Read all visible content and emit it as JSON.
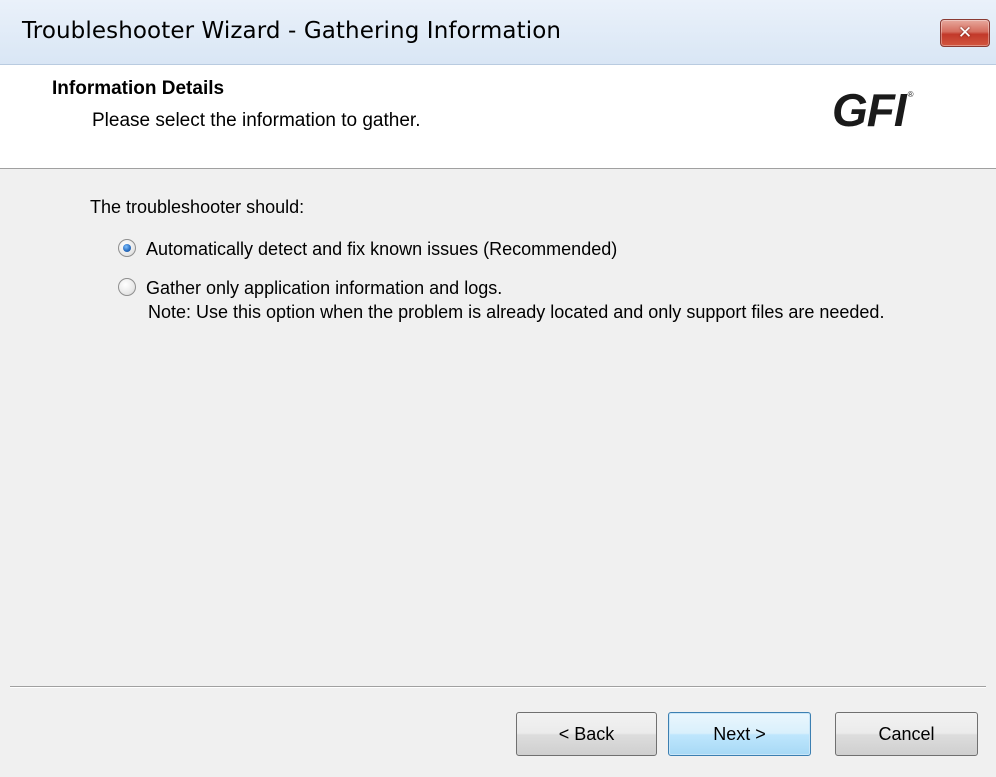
{
  "window": {
    "title": "Troubleshooter Wizard - Gathering Information",
    "close_glyph": "✕",
    "close_icon": "close-icon"
  },
  "header": {
    "title": "Information Details",
    "subtitle": "Please select the information to gather.",
    "logo_text": "GFI",
    "logo_mark": "®"
  },
  "main": {
    "prompt": "The troubleshooter should:",
    "options": [
      {
        "label": "Automatically detect and fix known issues (Recommended)",
        "selected": true
      },
      {
        "label": "Gather only application information and logs.",
        "note": "Note: Use this option when the problem is already located and only support files are needed.",
        "selected": false
      }
    ]
  },
  "footer": {
    "back_label": "< Back",
    "next_label": "Next >",
    "cancel_label": "Cancel"
  },
  "colors": {
    "accent": "#3c7fb1",
    "close_red": "#c2392a",
    "dialog_bg": "#f0f0f0"
  }
}
